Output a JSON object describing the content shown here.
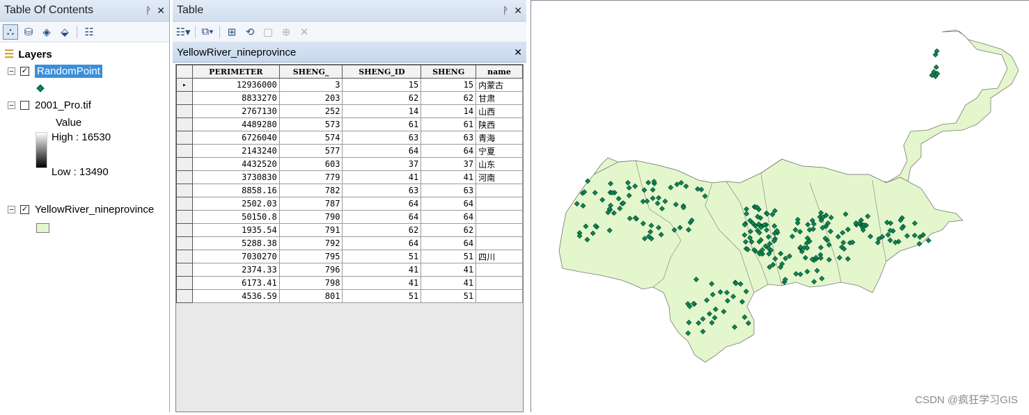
{
  "toc": {
    "title": "Table Of Contents",
    "root_label": "Layers",
    "layers": [
      {
        "name": "RandomPoint",
        "checked": true
      },
      {
        "name": "2001_Pro.tif",
        "checked": false,
        "legend_title": "Value",
        "high_label": "High : 16530",
        "low_label": "Low : 13490"
      },
      {
        "name": "YellowRiver_nineprovince",
        "checked": true
      }
    ]
  },
  "table_window": {
    "title": "Table",
    "tab_title": "YellowRiver_nineprovince",
    "columns": [
      "PERIMETER",
      "SHENG_",
      "SHENG_ID",
      "SHENG",
      "name"
    ],
    "rows": [
      [
        "12936000",
        "3",
        "15",
        "15",
        "内蒙古"
      ],
      [
        "8833270",
        "203",
        "62",
        "62",
        "甘肃"
      ],
      [
        "2767130",
        "252",
        "14",
        "14",
        "山西"
      ],
      [
        "4489280",
        "573",
        "61",
        "61",
        "陕西"
      ],
      [
        "6726040",
        "574",
        "63",
        "63",
        "青海"
      ],
      [
        "2143240",
        "577",
        "64",
        "64",
        "宁夏"
      ],
      [
        "4432520",
        "603",
        "37",
        "37",
        "山东"
      ],
      [
        "3730830",
        "779",
        "41",
        "41",
        "河南"
      ],
      [
        "8858.16",
        "782",
        "63",
        "63",
        ""
      ],
      [
        "2502.03",
        "787",
        "64",
        "64",
        ""
      ],
      [
        "50150.8",
        "790",
        "64",
        "64",
        ""
      ],
      [
        "1935.54",
        "791",
        "62",
        "62",
        ""
      ],
      [
        "5288.38",
        "792",
        "64",
        "64",
        ""
      ],
      [
        "7030270",
        "795",
        "51",
        "51",
        "四川"
      ],
      [
        "2374.33",
        "796",
        "41",
        "41",
        ""
      ],
      [
        "6173.41",
        "798",
        "41",
        "41",
        ""
      ],
      [
        "4536.59",
        "801",
        "51",
        "51",
        ""
      ]
    ]
  },
  "map": {
    "polygon_fill": "#e4f6cc",
    "point_color": "#0a8a4a"
  },
  "watermark": "CSDN @疯狂学习GIS"
}
